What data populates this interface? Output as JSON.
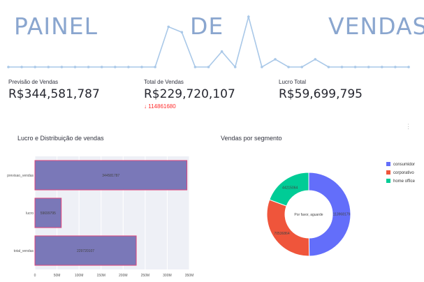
{
  "header": {
    "title_words": [
      "PAINEL",
      "DE",
      "VENDAS"
    ],
    "title_color": "#8aa6cf"
  },
  "sparkline": {
    "values": [
      0,
      0,
      0,
      0,
      0,
      0,
      0,
      0,
      0,
      0,
      0,
      0,
      5.2,
      4.5,
      0,
      0,
      2.0,
      0,
      6.5,
      0,
      1.0,
      0,
      0,
      1.0,
      0,
      0,
      0,
      0,
      0,
      0,
      0
    ],
    "color": "#a9c8e8"
  },
  "metrics": [
    {
      "label": "Previsão de Vendas",
      "value": "R$344,581,787"
    },
    {
      "label": "Total de Vendas",
      "value": "R$229,720,107",
      "delta": "114861680",
      "delta_icon": "arrow-down-icon"
    },
    {
      "label": "Lucro Total",
      "value": "R$59,699,795"
    }
  ],
  "chart_data": [
    {
      "type": "bar",
      "orientation": "horizontal",
      "title": "Lucro e Distribuição de vendas",
      "categories": [
        "previsao_vendas",
        "lucro",
        "total_vendas"
      ],
      "values": [
        344581787,
        59699795,
        229720107
      ],
      "value_labels": [
        "344581787",
        "59699795",
        "229720107"
      ],
      "xlim": [
        0,
        350000000
      ],
      "ticks": [
        0,
        50000000,
        100000000,
        150000000,
        200000000,
        250000000,
        300000000,
        350000000
      ],
      "tick_labels": [
        "0",
        "50M",
        "100M",
        "150M",
        "200M",
        "250M",
        "300M",
        "350M"
      ],
      "bar_color": "#7a78b8",
      "bar_border": "#e0457b",
      "plot_bg": "#eef0f6"
    },
    {
      "type": "pie",
      "hole": true,
      "title": "Vendas por segmento",
      "labels": [
        "consumidor",
        "corporativo",
        "home office"
      ],
      "values": [
        113968179,
        70536864,
        44215064
      ],
      "value_labels": [
        "113968179",
        "70536864",
        "44215064"
      ],
      "colors": [
        "#636efa",
        "#ef553b",
        "#00cc96"
      ],
      "legend_position": "right",
      "hover_text": "Por favor, aguarde"
    }
  ]
}
